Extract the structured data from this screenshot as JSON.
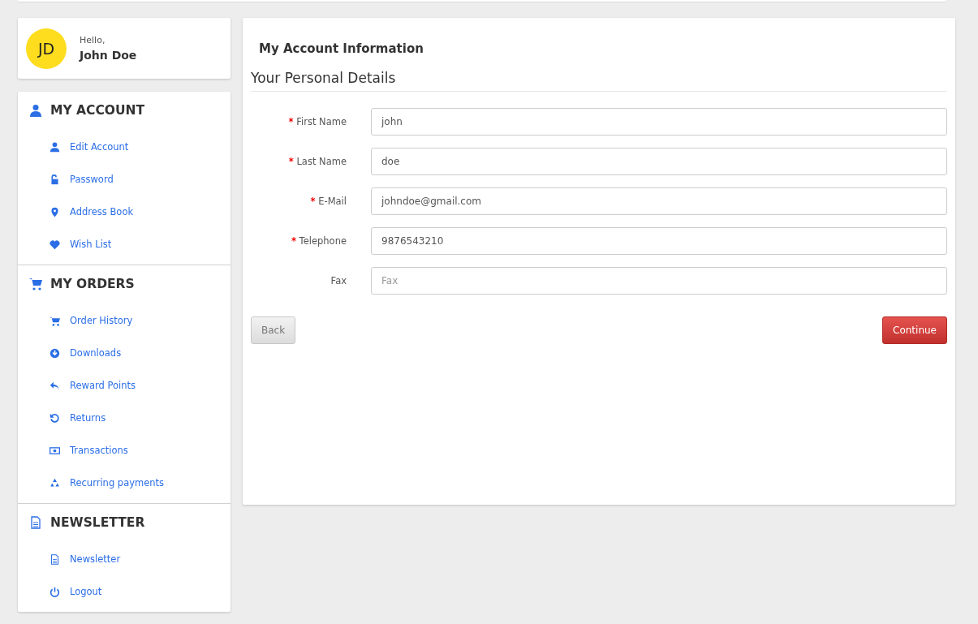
{
  "profile": {
    "initials": "JD",
    "greeting": "Hello,",
    "name": "John Doe"
  },
  "sidebar": {
    "sections": [
      {
        "title": "MY ACCOUNT",
        "items": [
          {
            "label": "Edit Account"
          },
          {
            "label": "Password"
          },
          {
            "label": "Address Book"
          },
          {
            "label": "Wish List"
          }
        ]
      },
      {
        "title": "MY ORDERS",
        "items": [
          {
            "label": "Order History"
          },
          {
            "label": "Downloads"
          },
          {
            "label": "Reward Points"
          },
          {
            "label": "Returns"
          },
          {
            "label": "Transactions"
          },
          {
            "label": "Recurring payments"
          }
        ]
      },
      {
        "title": "NEWSLETTER",
        "items": [
          {
            "label": "Newsletter"
          },
          {
            "label": "Logout"
          }
        ]
      }
    ]
  },
  "main": {
    "title": "My Account Information",
    "legend": "Your Personal Details",
    "fields": [
      {
        "label": "First Name",
        "required": true,
        "value": "john"
      },
      {
        "label": "Last Name",
        "required": true,
        "value": "doe"
      },
      {
        "label": "E-Mail",
        "required": true,
        "value": "johndoe@gmail.com"
      },
      {
        "label": "Telephone",
        "required": true,
        "value": "9876543210"
      },
      {
        "label": "Fax",
        "required": false,
        "placeholder": "Fax"
      }
    ],
    "required_mark": "*",
    "buttons": [
      {
        "label": "Back",
        "kind": "default"
      },
      {
        "label": "Continue",
        "kind": "primary"
      }
    ]
  }
}
